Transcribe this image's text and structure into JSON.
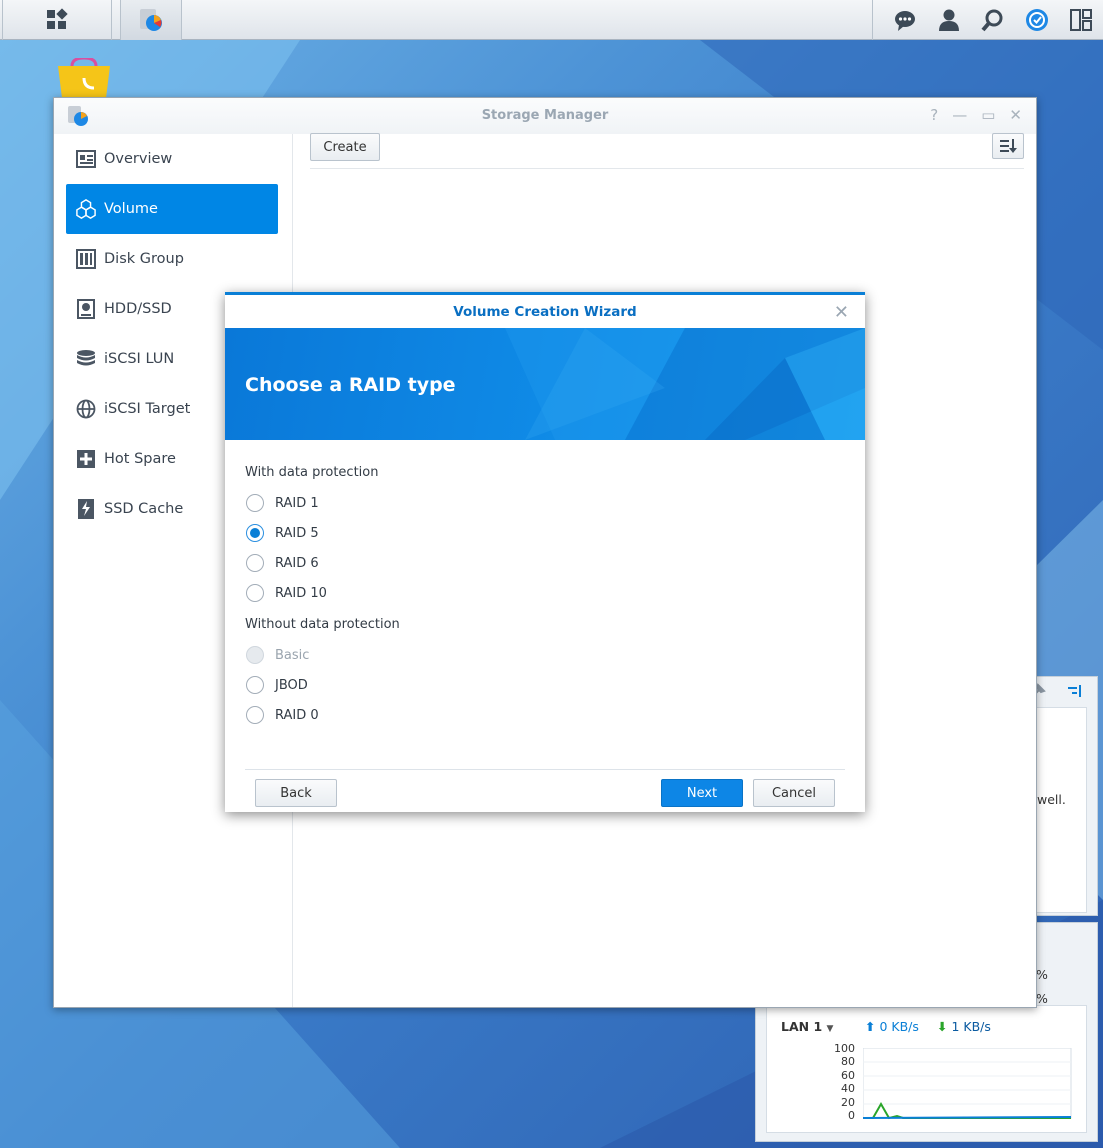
{
  "taskbar": {
    "icons": [
      "main-menu-icon",
      "storage-manager-icon",
      "chat-icon",
      "user-icon",
      "search-icon",
      "dsm-icon",
      "widgets-icon"
    ]
  },
  "window": {
    "title": "Storage Manager",
    "controls": [
      "help-icon",
      "minimize-icon",
      "maximize-icon",
      "close-icon"
    ],
    "sidebar": {
      "items": [
        {
          "label": "Overview",
          "icon": "overview-icon",
          "active": false
        },
        {
          "label": "Volume",
          "icon": "volume-icon",
          "active": true
        },
        {
          "label": "Disk Group",
          "icon": "disk-group-icon",
          "active": false
        },
        {
          "label": "HDD/SSD",
          "icon": "hdd-icon",
          "active": false
        },
        {
          "label": "iSCSI LUN",
          "icon": "iscsi-lun-icon",
          "active": false
        },
        {
          "label": "iSCSI Target",
          "icon": "iscsi-target-icon",
          "active": false
        },
        {
          "label": "Hot Spare",
          "icon": "hot-spare-icon",
          "active": false
        },
        {
          "label": "SSD Cache",
          "icon": "ssd-cache-icon",
          "active": false
        }
      ]
    },
    "toolbar": {
      "create_label": "Create"
    }
  },
  "dialog": {
    "title": "Volume Creation Wizard",
    "heading": "Choose a RAID type",
    "section_protected": "With data protection",
    "section_unprotected": "Without data protection",
    "protected_options": [
      {
        "label": "RAID 1",
        "checked": false,
        "disabled": false
      },
      {
        "label": "RAID 5",
        "checked": true,
        "disabled": false
      },
      {
        "label": "RAID 6",
        "checked": false,
        "disabled": false
      },
      {
        "label": "RAID 10",
        "checked": false,
        "disabled": false
      }
    ],
    "unprotected_options": [
      {
        "label": "Basic",
        "checked": false,
        "disabled": true
      },
      {
        "label": "JBOD",
        "checked": false,
        "disabled": false
      },
      {
        "label": "RAID 0",
        "checked": false,
        "disabled": false
      }
    ],
    "buttons": {
      "back": "Back",
      "next": "Next",
      "cancel": "Cancel"
    }
  },
  "widget_text": {
    "partial_text": "well.",
    "percent_1": "%",
    "percent_2": "%",
    "lan_label": "LAN 1",
    "upload": "0 KB/s",
    "download": "1 KB/s",
    "y_ticks": [
      "100",
      "80",
      "60",
      "40",
      "20",
      "0"
    ]
  },
  "colors": {
    "accent": "#0086e5",
    "upload": "#0a7fd6",
    "download": "#2aa52a"
  }
}
